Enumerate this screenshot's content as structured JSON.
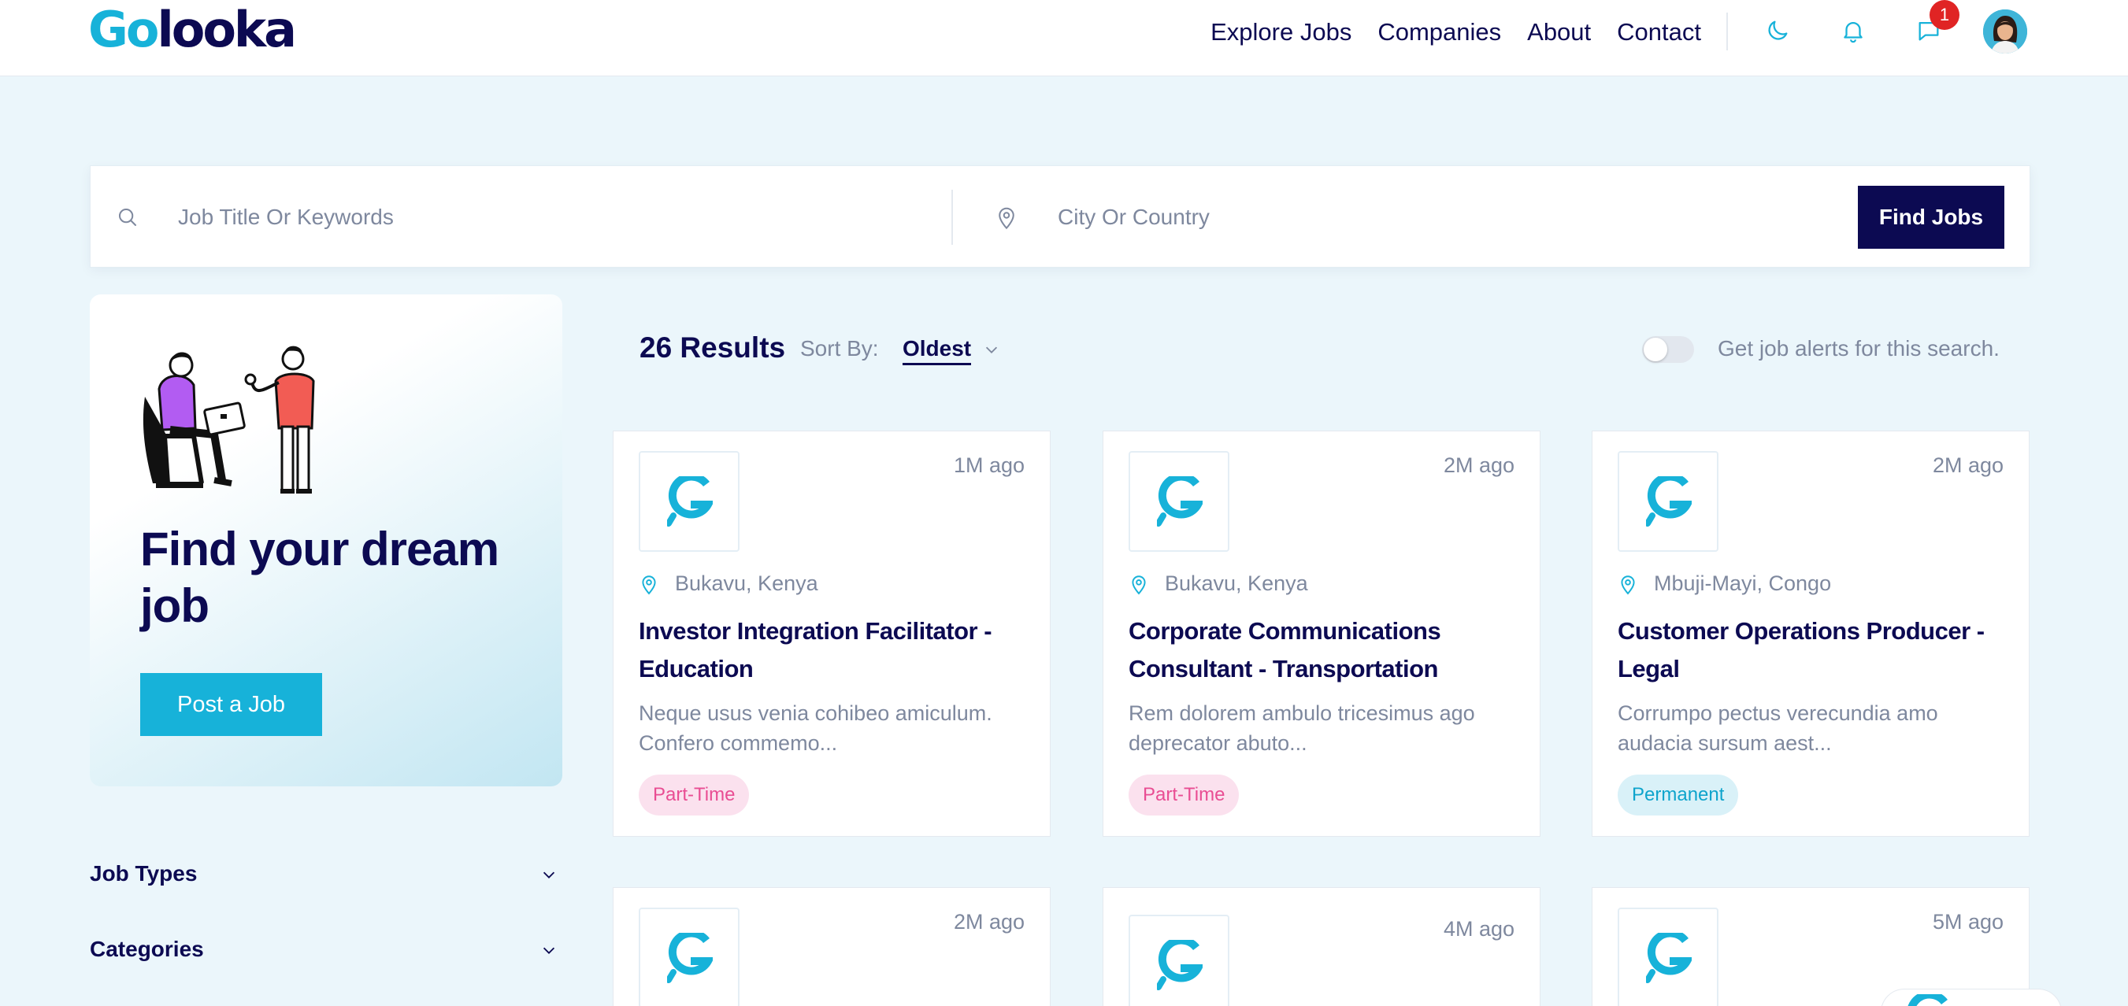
{
  "brand": {
    "logo_part1": "Go",
    "logo_part2": "looka"
  },
  "nav": {
    "items": [
      "Explore Jobs",
      "Companies",
      "About",
      "Contact"
    ],
    "notification_count": "1",
    "icons": [
      "moon-icon",
      "bell-icon",
      "chat-icon"
    ]
  },
  "search": {
    "keyword_placeholder": "Job Title Or Keywords",
    "location_placeholder": "City Or Country",
    "button_label": "Find Jobs"
  },
  "hero": {
    "title": "Find your dream job",
    "button_label": "Post a Job"
  },
  "filters": [
    {
      "label": "Job Types"
    },
    {
      "label": "Categories"
    }
  ],
  "results": {
    "count_label": "26 Results",
    "sort_label": "Sort By:",
    "sort_value": "Oldest",
    "alert_label": "Get job alerts for this search.",
    "alert_enabled": false
  },
  "jobs": [
    {
      "time": "1M ago",
      "location": "Bukavu, Kenya",
      "title": "Investor Integration Facilitator - Education",
      "description": "Neque usus venia cohibeo amiculum. Confero commemo...",
      "tag": "Part-Time"
    },
    {
      "time": "2M ago",
      "location": "Bukavu, Kenya",
      "title": "Corporate Communications Consultant - Transportation",
      "description": "Rem dolorem ambulo tricesimus ago deprecator abuto...",
      "tag": "Part-Time"
    },
    {
      "time": "2M ago",
      "location": "Mbuji-Mayi, Congo",
      "title": "Customer Operations Producer - Legal",
      "description": "Corrumpo pectus verecundia amo audacia sursum aest...",
      "tag": "Permanent"
    },
    {
      "time": "2M ago"
    },
    {
      "time": "4M ago"
    },
    {
      "time": "5M ago"
    }
  ],
  "colors": {
    "primary": "#0c0a52",
    "accent": "#17b2d9",
    "background": "#ebf6fb",
    "muted": "#7e889e"
  }
}
